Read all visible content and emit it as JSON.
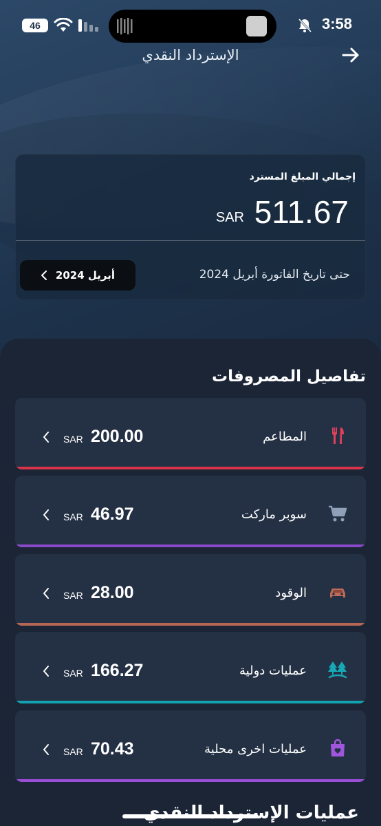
{
  "status_bar": {
    "time": "3:58",
    "battery": "46",
    "icons": [
      "bell-off-icon",
      "wifi-icon",
      "signal-icon"
    ]
  },
  "header": {
    "title": "الإسترداد النقدي",
    "back_icon": "arrow-right-icon"
  },
  "summary": {
    "label": "إجمالي المبلغ المسترد",
    "amount": "511.67",
    "currency": "SAR",
    "period_text": "حتى تاريخ الفاتورة  أبريل 2024",
    "date_button": "أبريل 2024"
  },
  "expenses": {
    "title": "تفاصيل المصروفات",
    "items": [
      {
        "name": "المطاعم",
        "value": "200.00",
        "currency": "SAR",
        "icon": "fork-knife-icon",
        "color": "#d9344a"
      },
      {
        "name": "سوبر ماركت",
        "value": "46.97",
        "currency": "SAR",
        "icon": "cart-icon",
        "color": "#8a49c7"
      },
      {
        "name": "الوقود",
        "value": "28.00",
        "currency": "SAR",
        "icon": "car-icon",
        "color": "#b56654"
      },
      {
        "name": "عمليات دولية",
        "value": "166.27",
        "currency": "SAR",
        "icon": "trees-icon",
        "color": "#13a3b0"
      },
      {
        "name": "عمليات اخرى محلية",
        "value": "70.43",
        "currency": "SAR",
        "icon": "bag-heart-icon",
        "color": "#9a4dd6"
      }
    ]
  },
  "bottom": {
    "title": "عمليات الإسترداد النقدي"
  }
}
